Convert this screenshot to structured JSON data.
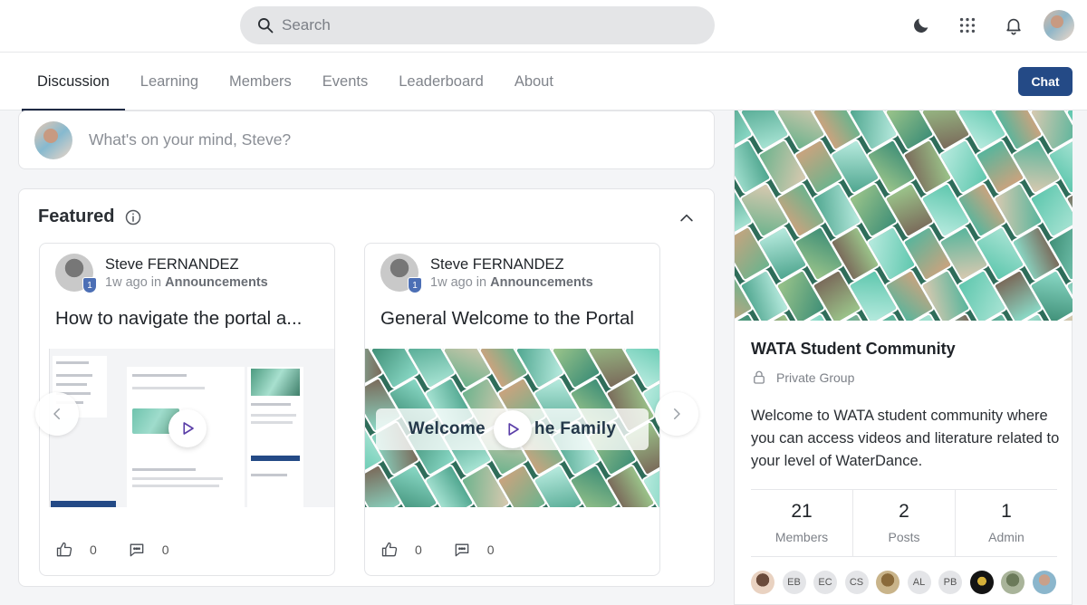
{
  "search": {
    "placeholder": "Search"
  },
  "header": {
    "icons": [
      "moon-icon",
      "apps-grid-icon",
      "bell-icon",
      "user-avatar"
    ]
  },
  "tabs": [
    {
      "label": "Discussion",
      "active": true
    },
    {
      "label": "Learning",
      "active": false
    },
    {
      "label": "Members",
      "active": false
    },
    {
      "label": "Events",
      "active": false
    },
    {
      "label": "Leaderboard",
      "active": false
    },
    {
      "label": "About",
      "active": false
    }
  ],
  "chat_label": "Chat",
  "composer": {
    "placeholder": "What's on your mind, Steve?"
  },
  "featured": {
    "title": "Featured",
    "posts": [
      {
        "author": "Steve FERNANDEZ",
        "level": "1",
        "time": "1w ago",
        "in_word": "in",
        "space": "Announcements",
        "title": "How to navigate the portal a...",
        "likes": "0",
        "comments": "0"
      },
      {
        "author": "Steve FERNANDEZ",
        "level": "1",
        "time": "1w ago",
        "in_word": "in",
        "space": "Announcements",
        "title": "General Welcome to the Portal",
        "video_caption_left": "Welcome",
        "video_caption_right": "he Family",
        "likes": "0",
        "comments": "0"
      }
    ]
  },
  "group": {
    "name": "WATA Student Community",
    "privacy": "Private Group",
    "description": "Welcome to WATA student community where you can access videos and literature related to your level of WaterDance.",
    "stats": [
      {
        "value": "21",
        "label": "Members"
      },
      {
        "value": "2",
        "label": "Posts"
      },
      {
        "value": "1",
        "label": "Admin"
      }
    ],
    "member_initials": [
      "EB",
      "EC",
      "CS",
      "AL",
      "PB"
    ]
  },
  "colors": {
    "accent": "#244a86",
    "tab_indicator": "#1f2a44",
    "badge": "#4c6fb5",
    "play": "#5b3fa8"
  }
}
